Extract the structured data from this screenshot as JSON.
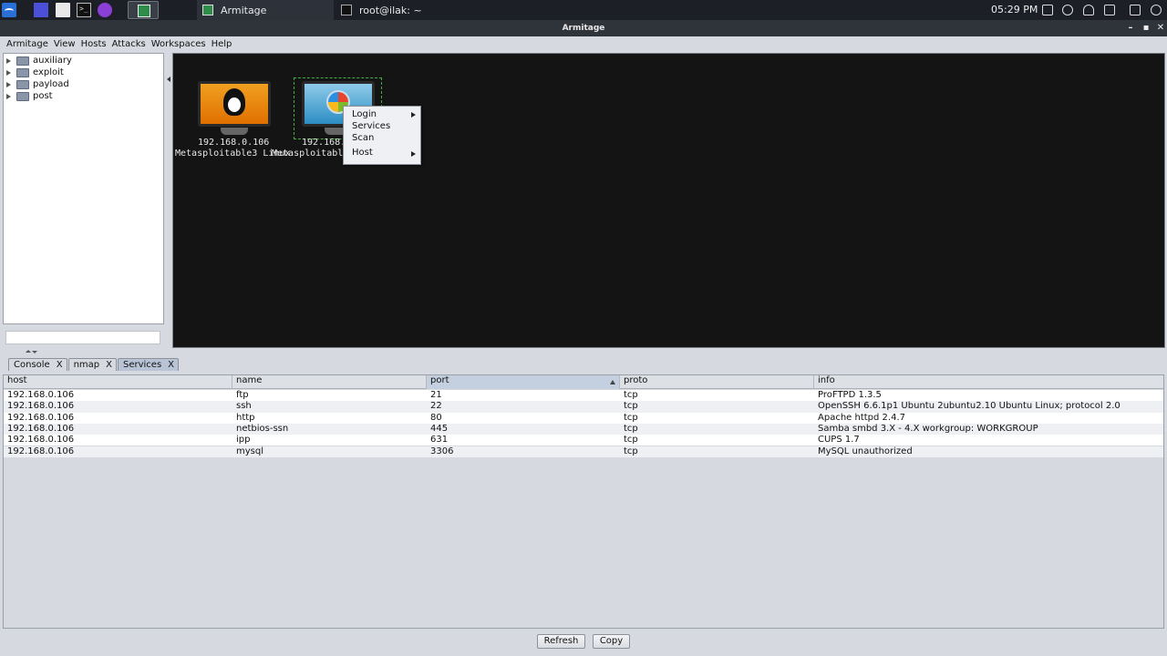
{
  "taskbar": {
    "tasks": [
      {
        "label": "Armitage"
      },
      {
        "label": "root@ilak: ~"
      }
    ],
    "clock": "05:29 PM"
  },
  "window": {
    "title": "Armitage"
  },
  "menubar": {
    "items": [
      "Armitage",
      "View",
      "Hosts",
      "Attacks",
      "Workspaces",
      "Help"
    ]
  },
  "module_tree": {
    "items": [
      "auxiliary",
      "exploit",
      "payload",
      "post"
    ],
    "search_value": ""
  },
  "graph": {
    "hosts": [
      {
        "ip": "192.168.0.106",
        "label": "Metasploitable3 Linux",
        "os": "linux"
      },
      {
        "ip": "192.168.0.1",
        "label": "Metasploitable",
        "os": "windows"
      }
    ]
  },
  "context_menu": {
    "items": [
      {
        "label": "Login",
        "submenu": true
      },
      {
        "label": "Services",
        "submenu": false
      },
      {
        "label": "Scan",
        "submenu": false
      },
      {
        "label": "Host",
        "submenu": true
      }
    ]
  },
  "tabs": [
    {
      "label": "Console",
      "close": "X"
    },
    {
      "label": "nmap",
      "close": "X"
    },
    {
      "label": "Services",
      "close": "X"
    }
  ],
  "services_table": {
    "columns": [
      "host",
      "name",
      "port",
      "proto",
      "info"
    ],
    "sorted_column": "port",
    "rows": [
      {
        "host": "192.168.0.106",
        "name": "ftp",
        "port": "21",
        "proto": "tcp",
        "info": "ProFTPD 1.3.5"
      },
      {
        "host": "192.168.0.106",
        "name": "ssh",
        "port": "22",
        "proto": "tcp",
        "info": "OpenSSH 6.6.1p1 Ubuntu 2ubuntu2.10 Ubuntu Linux; protocol 2.0"
      },
      {
        "host": "192.168.0.106",
        "name": "http",
        "port": "80",
        "proto": "tcp",
        "info": "Apache httpd 2.4.7"
      },
      {
        "host": "192.168.0.106",
        "name": "netbios-ssn",
        "port": "445",
        "proto": "tcp",
        "info": "Samba smbd 3.X - 4.X workgroup: WORKGROUP"
      },
      {
        "host": "192.168.0.106",
        "name": "ipp",
        "port": "631",
        "proto": "tcp",
        "info": "CUPS 1.7"
      },
      {
        "host": "192.168.0.106",
        "name": "mysql",
        "port": "3306",
        "proto": "tcp",
        "info": "MySQL unauthorized"
      }
    ]
  },
  "buttons": {
    "refresh": "Refresh",
    "copy": "Copy"
  }
}
